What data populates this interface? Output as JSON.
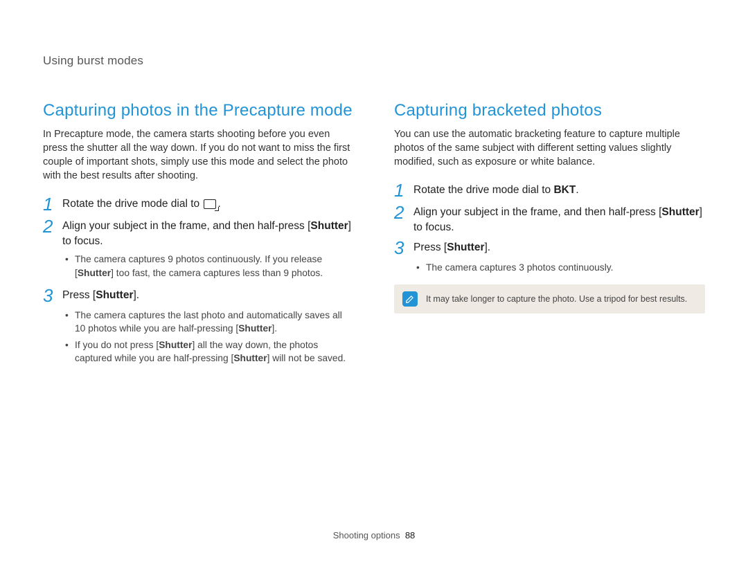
{
  "section_header": "Using burst modes",
  "left": {
    "title": "Capturing photos in the Precapture mode",
    "intro": "In Precapture mode, the camera starts shooting before you even press the shutter all the way down. If you do not want to miss the first couple of important shots, simply use this mode and select the photo with the best results after shooting.",
    "steps": {
      "s1": {
        "num": "1",
        "pre": "Rotate the drive mode dial to ",
        "post": "."
      },
      "s2": {
        "num": "2",
        "pre": "Align your subject in the frame, and then half-press [",
        "bold": "Shutter",
        "post": "] to focus."
      },
      "s2_bullets": {
        "b1_pre": "The camera captures 9 photos continuously. If you release [",
        "b1_bold": "Shutter",
        "b1_post": "] too fast, the camera captures less than 9 photos."
      },
      "s3": {
        "num": "3",
        "pre": "Press [",
        "bold": "Shutter",
        "post": "]."
      },
      "s3_bullets": {
        "b1_pre": "The camera captures the last photo and automatically saves all 10 photos while you are half-pressing [",
        "b1_bold": "Shutter",
        "b1_post": "].",
        "b2_pre": "If you do not press [",
        "b2_bold1": "Shutter",
        "b2_mid": "] all the way down, the photos captured while you are half-pressing [",
        "b2_bold2": "Shutter",
        "b2_post": "] will not be saved."
      }
    }
  },
  "right": {
    "title": "Capturing bracketed photos",
    "intro": "You can use the automatic bracketing feature to capture multiple photos of the same subject with different setting values slightly modified, such as exposure or white balance.",
    "steps": {
      "s1": {
        "num": "1",
        "pre": "Rotate the drive mode dial to ",
        "bold": "BKT",
        "post": "."
      },
      "s2": {
        "num": "2",
        "pre": "Align your subject in the frame, and then half-press [",
        "bold": "Shutter",
        "post": "] to focus."
      },
      "s3": {
        "num": "3",
        "pre": "Press [",
        "bold": "Shutter",
        "post": "]."
      },
      "s3_bullets": {
        "b1": "The camera captures 3 photos continuously."
      }
    },
    "note": "It may take longer to capture the photo. Use a tripod for best results."
  },
  "footer": {
    "section": "Shooting options",
    "page": "88"
  }
}
